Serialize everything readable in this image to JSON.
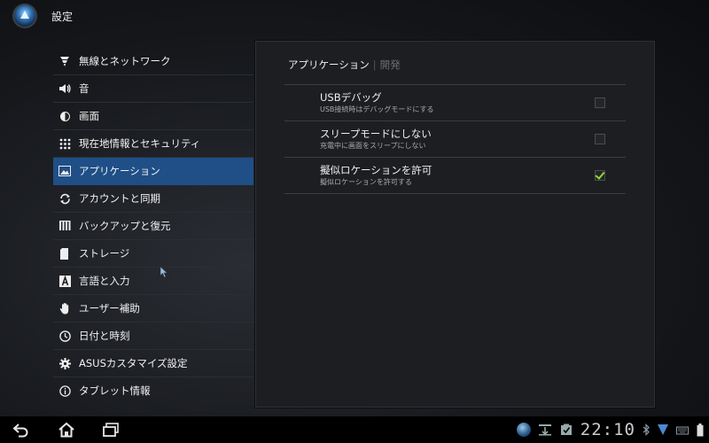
{
  "app": {
    "title": "設定"
  },
  "sidebar": {
    "items": [
      {
        "label": "無線とネットワーク",
        "icon": "wifi-icon",
        "selected": false
      },
      {
        "label": "音",
        "icon": "speaker-icon",
        "selected": false
      },
      {
        "label": "画面",
        "icon": "brightness-icon",
        "selected": false
      },
      {
        "label": "現在地情報とセキュリティ",
        "icon": "location-grid-icon",
        "selected": false
      },
      {
        "label": "アプリケーション",
        "icon": "applications-icon",
        "selected": true
      },
      {
        "label": "アカウントと同期",
        "icon": "sync-icon",
        "selected": false
      },
      {
        "label": "バックアップと復元",
        "icon": "backup-icon",
        "selected": false
      },
      {
        "label": "ストレージ",
        "icon": "storage-icon",
        "selected": false
      },
      {
        "label": "言語と入力",
        "icon": "language-icon",
        "selected": false
      },
      {
        "label": "ユーザー補助",
        "icon": "hand-icon",
        "selected": false
      },
      {
        "label": "日付と時刻",
        "icon": "clock-icon",
        "selected": false
      },
      {
        "label": "ASUSカスタマイズ設定",
        "icon": "gear-icon",
        "selected": false
      },
      {
        "label": "タブレット情報",
        "icon": "info-icon",
        "selected": false
      }
    ]
  },
  "panel": {
    "breadcrumb_current": "アプリケーション",
    "breadcrumb_next": "開発",
    "prefs": [
      {
        "title": "USBデバッグ",
        "summary": "USB接続時はデバッグモードにする",
        "checked": false
      },
      {
        "title": "スリープモードにしない",
        "summary": "充電中に画面をスリープにしない",
        "checked": false
      },
      {
        "title": "擬似ロケーションを許可",
        "summary": "擬似ロケーションを許可する",
        "checked": true
      }
    ]
  },
  "statusbar": {
    "time": "22:10"
  },
  "colors": {
    "selected": "#1f4f86",
    "check": "#8fdc32",
    "panel": "#1d1e21"
  }
}
